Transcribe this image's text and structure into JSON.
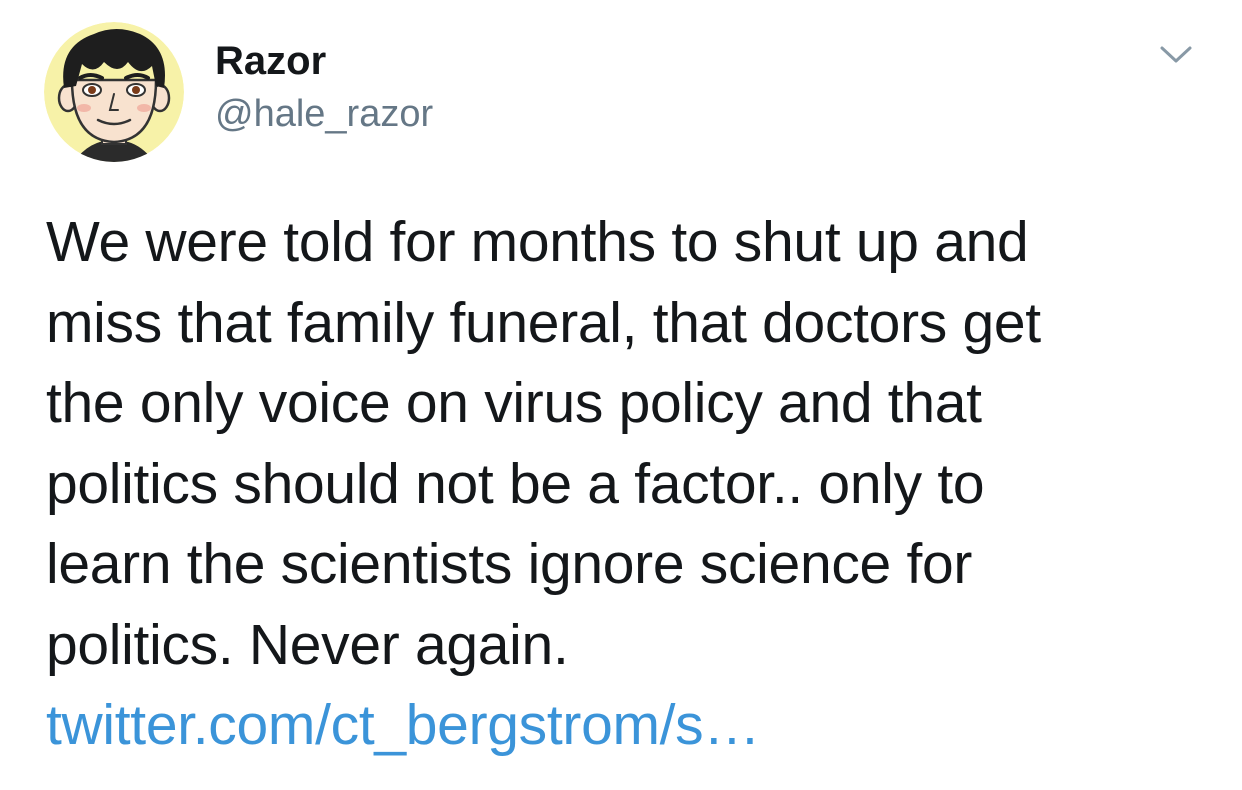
{
  "author": {
    "display_name": "Razor",
    "handle": "@hale_razor",
    "avatar_icon": "cartoon-face-avatar"
  },
  "menu": {
    "icon": "chevron-down-icon"
  },
  "tweet": {
    "lines": [
      "We were told for months to shut up and",
      "miss that family funeral, that doctors get",
      "the only voice on virus policy and that",
      "politics should not be a factor.. only to",
      "learn the scientists ignore science for",
      "politics. Never again."
    ],
    "link_text": "twitter.com/ct_bergstrom/s…"
  },
  "colors": {
    "text": "#14171a",
    "secondary_text": "#657786",
    "link": "#3b94d9",
    "chevron": "#8899a6",
    "avatar_bg": "#f7f2a8"
  }
}
